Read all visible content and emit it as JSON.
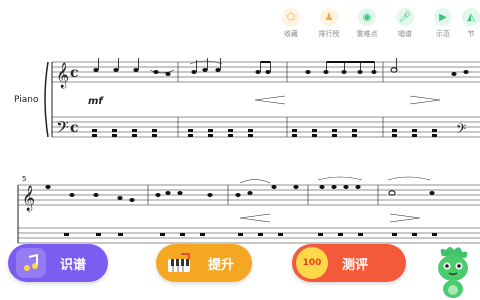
{
  "toolbar": {
    "items": [
      {
        "label": "收藏",
        "icon": "pentagon-icon",
        "color": "#f3a94a"
      },
      {
        "label": "排行榜",
        "icon": "person-icon",
        "color": "#f3a94a"
      },
      {
        "label": "重难点",
        "icon": "target-icon",
        "color": "#3cc47a"
      },
      {
        "label": "唱谱",
        "icon": "mic-icon",
        "color": "#3cc47a"
      },
      {
        "label": "示范",
        "icon": "play-icon",
        "color": "#3cc47a"
      },
      {
        "label": "节",
        "icon": "metronome-icon",
        "color": "#3cc47a"
      }
    ]
  },
  "score": {
    "instrument": "Piano",
    "dynamic": "mf",
    "measure_number": "5",
    "clef_treble": "𝄞",
    "clef_bass": "𝄢",
    "time": "c"
  },
  "actions": {
    "read_label": "识谱",
    "improve_label": "提升",
    "test_label": "测评",
    "test_badge": "100"
  }
}
